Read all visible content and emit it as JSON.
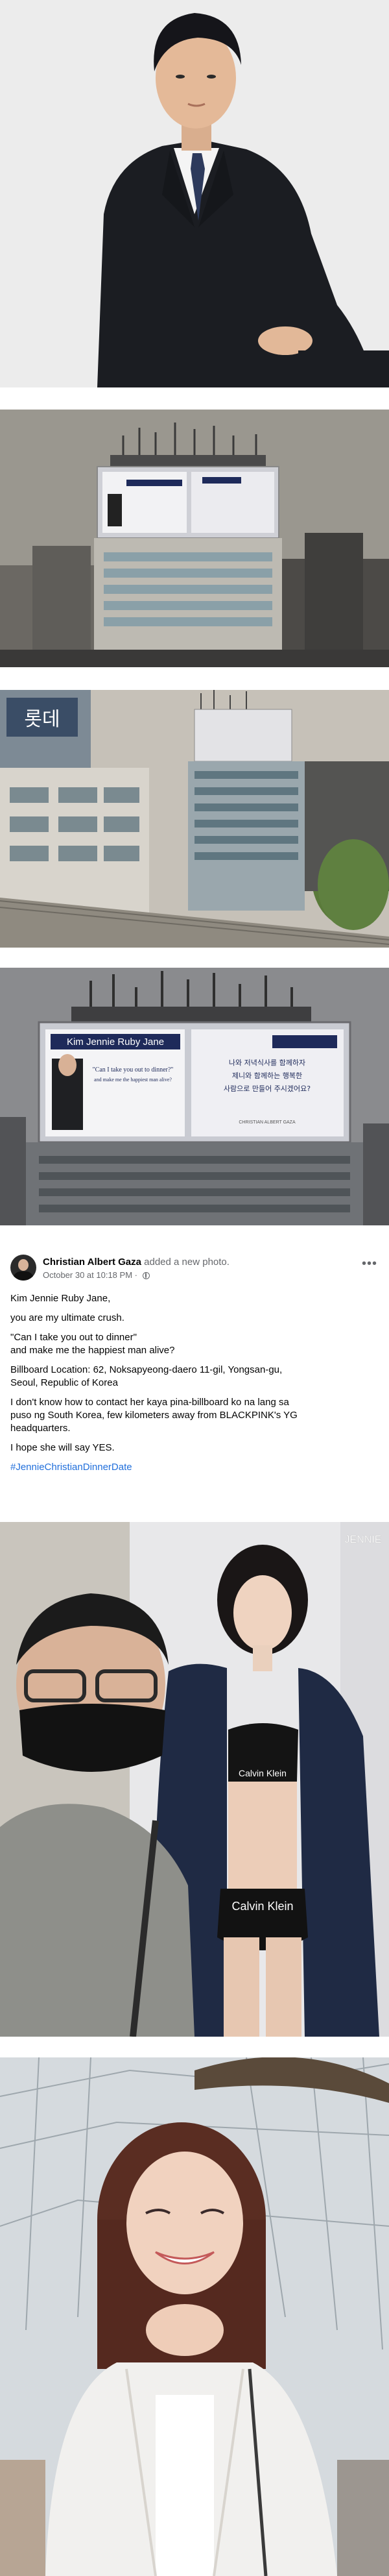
{
  "post": {
    "author_name": "Christian Albert Gaza",
    "action": "added a new photo.",
    "timestamp": "October 30 at 10:18 PM",
    "more_label": "•••",
    "paragraphs": {
      "p1": "Kim Jennie Ruby Jane,",
      "p2": "you are my ultimate crush.",
      "p3a": "\"Can I take you out to dinner\"",
      "p3b": "and make me the happiest man alive?",
      "p4a": "Billboard Location: 62, Noksapyeong-daero 11-gil, Yongsan-gu,",
      "p4b": "Seoul, Republic of Korea",
      "p5a": "I don't know how to contact her kaya pina-billboard ko na lang sa",
      "p5b": "puso ng South Korea, few kilometers away from BLACKPINK's YG",
      "p5c": "headquarters.",
      "p6": "I hope she will say YES.",
      "hashtag": "#JennieChristianDinnerDate"
    }
  },
  "billboard": {
    "left_title": "Kim Jennie Ruby Jane",
    "left_quote": "\"Can I take you out to dinner?\"",
    "left_quote2": "and make me the happiest man alive?",
    "right_line1": "나와 저녁식사를 함께하자",
    "right_line2": "제니와 함께하는 행복한",
    "right_line3": "사람으로 만들어 주시겠어요?",
    "signature": "CHRISTIAN ALBERT GAZA"
  },
  "storefront": {
    "sign_text": "롯데"
  },
  "photo5": {
    "watermark": "JENNIE",
    "brand_top": "Calvin Klein",
    "brand_bottom": "Calvin Klein"
  },
  "colors": {
    "link": "#216fdb",
    "muted": "#65676b",
    "text": "#050505"
  }
}
